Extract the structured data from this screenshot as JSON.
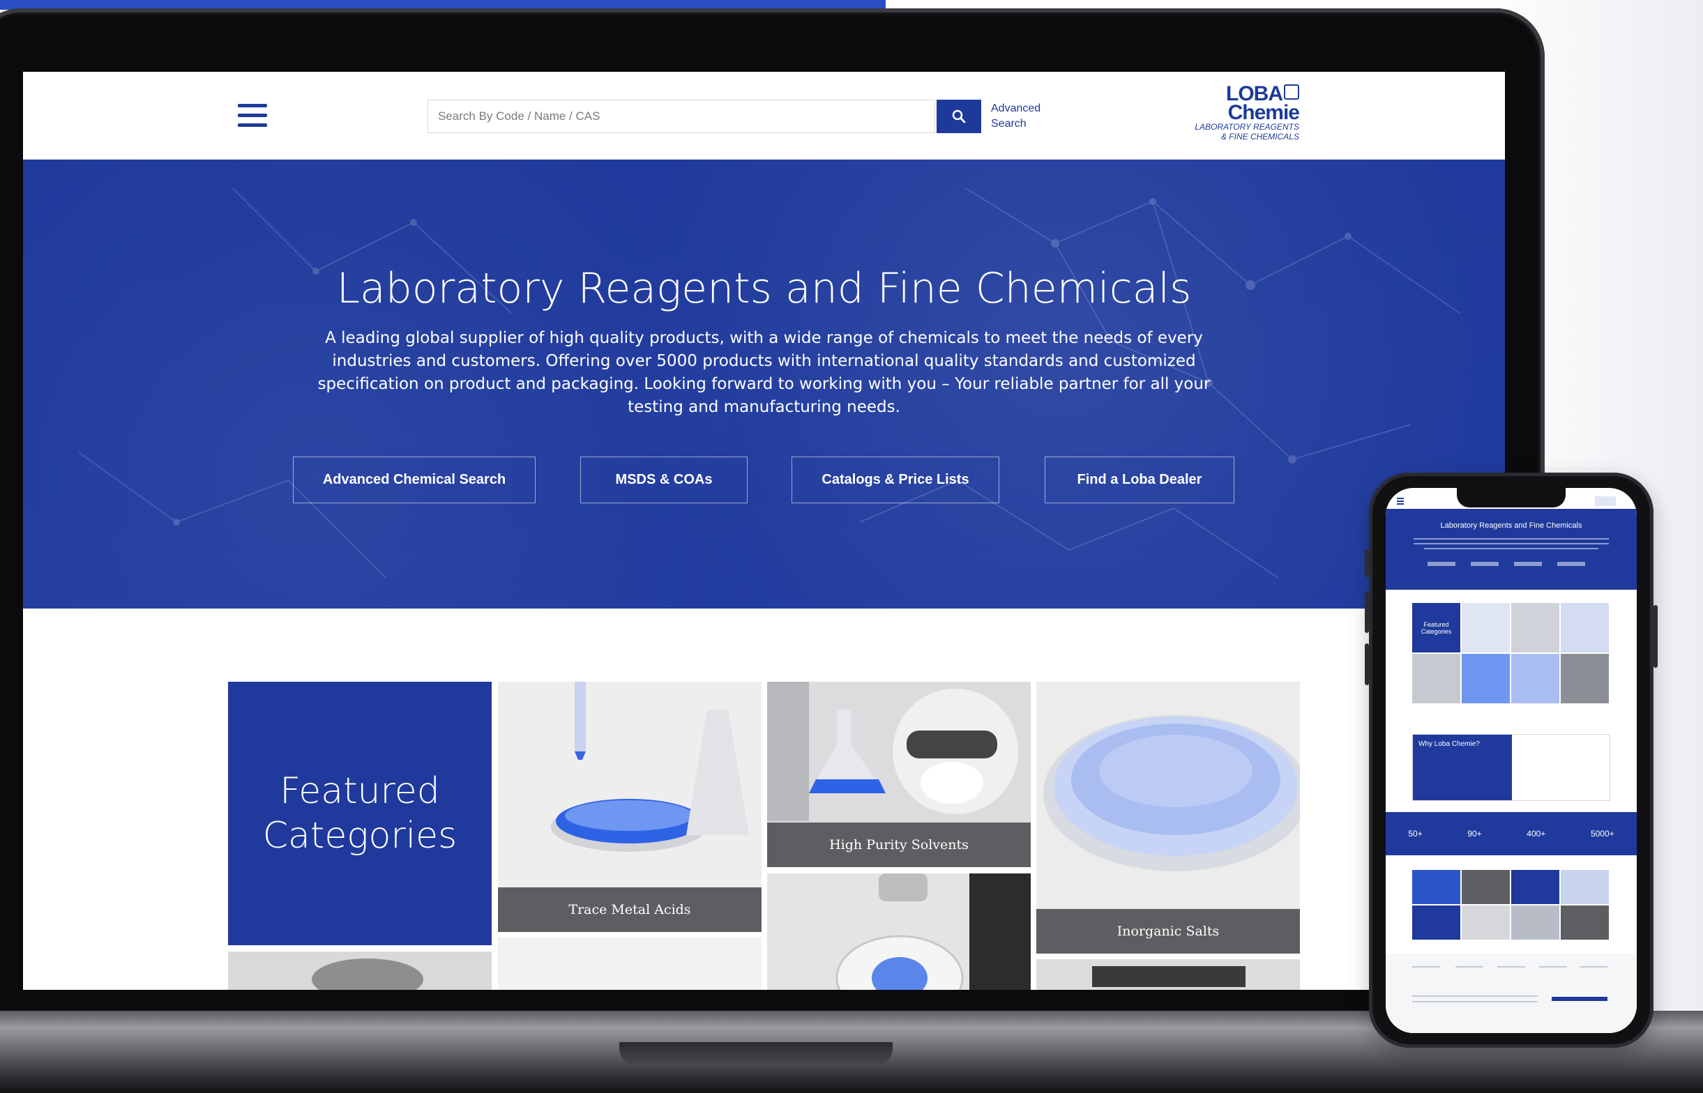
{
  "header": {
    "search_placeholder": "Search By Code / Name / CAS",
    "advanced_line1": "Advanced",
    "advanced_line2": "Search",
    "logo_line1": "LOBA",
    "logo_line2": "Chemie",
    "logo_line3": "LABORATORY REAGENTS",
    "logo_line4": "& FINE CHEMICALS"
  },
  "hero": {
    "title": "Laboratory Reagents and Fine Chemicals",
    "description": "A leading global supplier of high quality products, with a wide range of chemicals to meet the needs of every industries and customers. Offering over 5000 products with international quality standards and customized specification on product and packaging. Looking forward to working with you – Your reliable partner for all your testing and manufacturing needs.",
    "buttons": [
      {
        "label": "Advanced Chemical Search"
      },
      {
        "label": "MSDS & COAs"
      },
      {
        "label": "Catalogs & Price Lists"
      },
      {
        "label": "Find a Loba Dealer"
      }
    ]
  },
  "featured": {
    "title_line1": "Featured",
    "title_line2": "Categories",
    "tiles": [
      {
        "label": "Trace Metal Acids"
      },
      {
        "label": "High Purity Solvents"
      },
      {
        "label": "Inorganic Salts"
      }
    ]
  },
  "phone": {
    "hero_title": "Laboratory Reagents and Fine Chemicals",
    "featured_line1": "Featured",
    "featured_line2": "Categories",
    "why_title": "Why Loba Chemie?",
    "stats": [
      "50+",
      "90+",
      "400+",
      "5000+"
    ]
  },
  "colors": {
    "brand_blue": "#1f3a9c",
    "tile_label_gray": "#5d5e61",
    "accent_blue": "#2a4fc4"
  }
}
